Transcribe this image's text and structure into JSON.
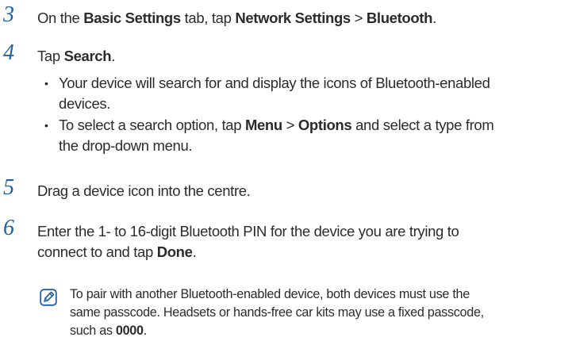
{
  "accent_color": "#1f5fa8",
  "steps": [
    {
      "num": "3",
      "parts": [
        {
          "t": "On the ",
          "b": false
        },
        {
          "t": "Basic Settings",
          "b": true
        },
        {
          "t": " tab, tap ",
          "b": false
        },
        {
          "t": "Network Settings",
          "b": true
        },
        {
          "t": " > ",
          "b": false
        },
        {
          "t": "Bluetooth",
          "b": true
        },
        {
          "t": ".",
          "b": false
        }
      ]
    },
    {
      "num": "4",
      "parts": [
        {
          "t": "Tap ",
          "b": false
        },
        {
          "t": "Search",
          "b": true
        },
        {
          "t": ".",
          "b": false
        }
      ],
      "bullets": [
        {
          "lines": [
            [
              {
                "t": "Your device will search for and display the icons of Bluetooth-enabled",
                "b": false
              }
            ],
            [
              {
                "t": "devices.",
                "b": false
              }
            ]
          ]
        },
        {
          "lines": [
            [
              {
                "t": "To select a search option, tap ",
                "b": false
              },
              {
                "t": "Menu",
                "b": true
              },
              {
                "t": " > ",
                "b": false
              },
              {
                "t": "Options",
                "b": true
              },
              {
                "t": " and select a type from",
                "b": false
              }
            ],
            [
              {
                "t": "the drop-down menu.",
                "b": false
              }
            ]
          ]
        }
      ]
    },
    {
      "num": "5",
      "parts": [
        {
          "t": "Drag a device icon into the centre.",
          "b": false
        }
      ]
    },
    {
      "num": "6",
      "lines": [
        [
          {
            "t": "Enter the 1- to 16-digit Bluetooth PIN for the device you are trying to",
            "b": false
          }
        ],
        [
          {
            "t": "connect to and tap ",
            "b": false
          },
          {
            "t": "Done",
            "b": true
          },
          {
            "t": ".",
            "b": false
          }
        ]
      ]
    }
  ],
  "note": {
    "icon": "note-pencil-icon",
    "lines": [
      [
        {
          "t": "To pair with another Bluetooth-enabled device, both devices must use the",
          "b": false
        }
      ],
      [
        {
          "t": "same passcode. Headsets or hands-free car kits may use a fixed passcode,",
          "b": false
        }
      ],
      [
        {
          "t": "such as ",
          "b": false
        },
        {
          "t": "0000",
          "b": true
        },
        {
          "t": ".",
          "b": false
        }
      ]
    ]
  }
}
